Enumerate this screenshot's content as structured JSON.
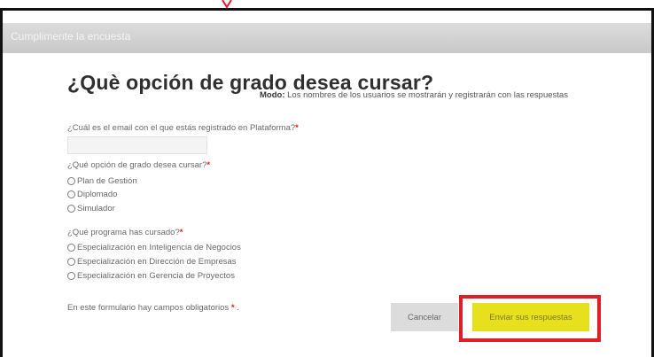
{
  "window": {
    "title": "Cumplimente la encuesta"
  },
  "form": {
    "title": "¿Què opción de grado desea cursar?",
    "mode_label": "Modo:",
    "mode_text": " Los nombres de los usuarios se mostrarán y registrarán con las respuestas",
    "required_marker": "*",
    "questions": [
      {
        "label": "¿Cuál es el email con el que estás registrado en Plataforma?",
        "input_value": ""
      },
      {
        "label": "¿Qué opción de grado desea cursar?",
        "options": [
          "Plan de Gestión",
          "Diplomado",
          "Simulador"
        ]
      },
      {
        "label": "¿Qué programa has cursado?",
        "options": [
          "Especialización en Inteligencia de Negocios",
          "Especialización en Dirección de Empresas",
          "Especialización en Gerencia de Proyectos"
        ]
      }
    ],
    "footer_note": "En este formulario hay campos obligatorios",
    "footer_suffix": ".",
    "cancel_label": "Cancelar",
    "submit_label": "Enviar sus respuestas"
  },
  "colors": {
    "required": "#e21b1b",
    "submit_button": "#e7e01c",
    "highlight_box": "#e01e26",
    "cancel_button": "#dcdcdc"
  },
  "icons": {
    "radio": "radio-circle-icon",
    "annotation": "red-arrow-tip-icon"
  }
}
